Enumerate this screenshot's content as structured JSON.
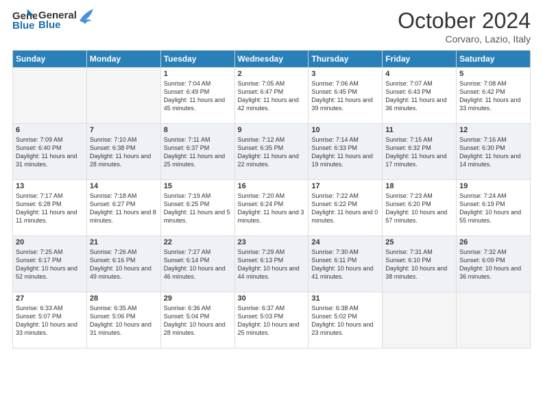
{
  "header": {
    "logo_general": "General",
    "logo_blue": "Blue",
    "title": "October 2024",
    "location": "Corvaro, Lazio, Italy"
  },
  "days_of_week": [
    "Sunday",
    "Monday",
    "Tuesday",
    "Wednesday",
    "Thursday",
    "Friday",
    "Saturday"
  ],
  "weeks": [
    {
      "shade": false,
      "days": [
        {
          "num": "",
          "info": ""
        },
        {
          "num": "",
          "info": ""
        },
        {
          "num": "1",
          "info": "Sunrise: 7:04 AM\nSunset: 6:49 PM\nDaylight: 11 hours and 45 minutes."
        },
        {
          "num": "2",
          "info": "Sunrise: 7:05 AM\nSunset: 6:47 PM\nDaylight: 11 hours and 42 minutes."
        },
        {
          "num": "3",
          "info": "Sunrise: 7:06 AM\nSunset: 6:45 PM\nDaylight: 11 hours and 39 minutes."
        },
        {
          "num": "4",
          "info": "Sunrise: 7:07 AM\nSunset: 6:43 PM\nDaylight: 11 hours and 36 minutes."
        },
        {
          "num": "5",
          "info": "Sunrise: 7:08 AM\nSunset: 6:42 PM\nDaylight: 11 hours and 33 minutes."
        }
      ]
    },
    {
      "shade": true,
      "days": [
        {
          "num": "6",
          "info": "Sunrise: 7:09 AM\nSunset: 6:40 PM\nDaylight: 11 hours and 31 minutes."
        },
        {
          "num": "7",
          "info": "Sunrise: 7:10 AM\nSunset: 6:38 PM\nDaylight: 11 hours and 28 minutes."
        },
        {
          "num": "8",
          "info": "Sunrise: 7:11 AM\nSunset: 6:37 PM\nDaylight: 11 hours and 25 minutes."
        },
        {
          "num": "9",
          "info": "Sunrise: 7:12 AM\nSunset: 6:35 PM\nDaylight: 11 hours and 22 minutes."
        },
        {
          "num": "10",
          "info": "Sunrise: 7:14 AM\nSunset: 6:33 PM\nDaylight: 11 hours and 19 minutes."
        },
        {
          "num": "11",
          "info": "Sunrise: 7:15 AM\nSunset: 6:32 PM\nDaylight: 11 hours and 17 minutes."
        },
        {
          "num": "12",
          "info": "Sunrise: 7:16 AM\nSunset: 6:30 PM\nDaylight: 11 hours and 14 minutes."
        }
      ]
    },
    {
      "shade": false,
      "days": [
        {
          "num": "13",
          "info": "Sunrise: 7:17 AM\nSunset: 6:28 PM\nDaylight: 11 hours and 11 minutes."
        },
        {
          "num": "14",
          "info": "Sunrise: 7:18 AM\nSunset: 6:27 PM\nDaylight: 11 hours and 8 minutes."
        },
        {
          "num": "15",
          "info": "Sunrise: 7:19 AM\nSunset: 6:25 PM\nDaylight: 11 hours and 5 minutes."
        },
        {
          "num": "16",
          "info": "Sunrise: 7:20 AM\nSunset: 6:24 PM\nDaylight: 11 hours and 3 minutes."
        },
        {
          "num": "17",
          "info": "Sunrise: 7:22 AM\nSunset: 6:22 PM\nDaylight: 11 hours and 0 minutes."
        },
        {
          "num": "18",
          "info": "Sunrise: 7:23 AM\nSunset: 6:20 PM\nDaylight: 10 hours and 57 minutes."
        },
        {
          "num": "19",
          "info": "Sunrise: 7:24 AM\nSunset: 6:19 PM\nDaylight: 10 hours and 55 minutes."
        }
      ]
    },
    {
      "shade": true,
      "days": [
        {
          "num": "20",
          "info": "Sunrise: 7:25 AM\nSunset: 6:17 PM\nDaylight: 10 hours and 52 minutes."
        },
        {
          "num": "21",
          "info": "Sunrise: 7:26 AM\nSunset: 6:16 PM\nDaylight: 10 hours and 49 minutes."
        },
        {
          "num": "22",
          "info": "Sunrise: 7:27 AM\nSunset: 6:14 PM\nDaylight: 10 hours and 46 minutes."
        },
        {
          "num": "23",
          "info": "Sunrise: 7:29 AM\nSunset: 6:13 PM\nDaylight: 10 hours and 44 minutes."
        },
        {
          "num": "24",
          "info": "Sunrise: 7:30 AM\nSunset: 6:11 PM\nDaylight: 10 hours and 41 minutes."
        },
        {
          "num": "25",
          "info": "Sunrise: 7:31 AM\nSunset: 6:10 PM\nDaylight: 10 hours and 38 minutes."
        },
        {
          "num": "26",
          "info": "Sunrise: 7:32 AM\nSunset: 6:09 PM\nDaylight: 10 hours and 36 minutes."
        }
      ]
    },
    {
      "shade": false,
      "days": [
        {
          "num": "27",
          "info": "Sunrise: 6:33 AM\nSunset: 5:07 PM\nDaylight: 10 hours and 33 minutes."
        },
        {
          "num": "28",
          "info": "Sunrise: 6:35 AM\nSunset: 5:06 PM\nDaylight: 10 hours and 31 minutes."
        },
        {
          "num": "29",
          "info": "Sunrise: 6:36 AM\nSunset: 5:04 PM\nDaylight: 10 hours and 28 minutes."
        },
        {
          "num": "30",
          "info": "Sunrise: 6:37 AM\nSunset: 5:03 PM\nDaylight: 10 hours and 25 minutes."
        },
        {
          "num": "31",
          "info": "Sunrise: 6:38 AM\nSunset: 5:02 PM\nDaylight: 10 hours and 23 minutes."
        },
        {
          "num": "",
          "info": ""
        },
        {
          "num": "",
          "info": ""
        }
      ]
    }
  ]
}
